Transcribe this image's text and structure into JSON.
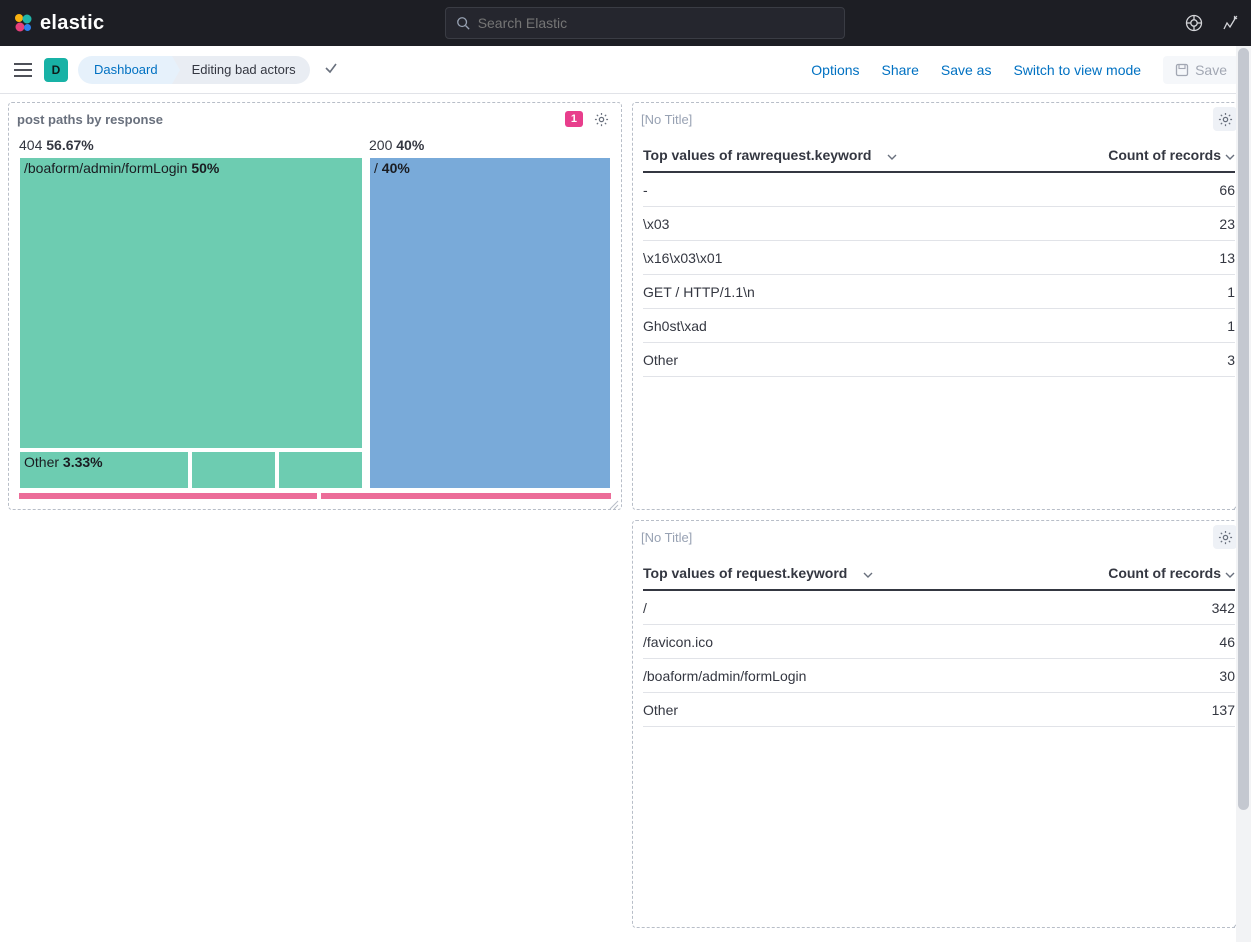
{
  "header": {
    "brand": "elastic",
    "search_placeholder": "Search Elastic"
  },
  "subheader": {
    "avatar_letter": "D",
    "crumb1": "Dashboard",
    "crumb2": "Editing bad actors",
    "options": "Options",
    "share": "Share",
    "save_as": "Save as",
    "switch": "Switch to view mode",
    "save": "Save"
  },
  "panel_treemap": {
    "title": "post paths by response",
    "badge": "1",
    "col404_label": "404",
    "col404_pct": "56.67%",
    "col200_label": "200",
    "col200_pct": "40%",
    "box404_top_label": "/boaform/admin/formLogin",
    "box404_top_pct": "50%",
    "box404_b1_label": "Other",
    "box404_b1_pct": "3.33%",
    "box200_label": "/",
    "box200_pct": "40%"
  },
  "panel_table1": {
    "title": "[No Title]",
    "th_left": "Top values of rawrequest.keyword",
    "th_right": "Count of records",
    "rows": [
      {
        "k": "-",
        "v": "66"
      },
      {
        "k": "\\x03",
        "v": "23"
      },
      {
        "k": "\\x16\\x03\\x01",
        "v": "13"
      },
      {
        "k": "GET / HTTP/1.1\\n",
        "v": "1"
      },
      {
        "k": "Gh0st\\xad",
        "v": "1"
      },
      {
        "k": "Other",
        "v": "3"
      }
    ]
  },
  "panel_table2": {
    "title": "[No Title]",
    "th_left": "Top values of request.keyword",
    "th_right": "Count of records",
    "rows": [
      {
        "k": "/",
        "v": "342"
      },
      {
        "k": "/favicon.ico",
        "v": "46"
      },
      {
        "k": "/boaform/admin/formLogin",
        "v": "30"
      },
      {
        "k": "Other",
        "v": "137"
      }
    ]
  },
  "chart_data": {
    "type": "treemap",
    "title": "post paths by response",
    "hierarchy": [
      {
        "group": "404",
        "pct": 56.67,
        "children": [
          {
            "label": "/boaform/admin/formLogin",
            "pct": 50
          },
          {
            "label": "Other",
            "pct": 3.33
          },
          {
            "label": "",
            "pct": 1.67
          },
          {
            "label": "",
            "pct": 1.67
          }
        ]
      },
      {
        "group": "200",
        "pct": 40,
        "children": [
          {
            "label": "/",
            "pct": 40
          }
        ]
      }
    ]
  }
}
